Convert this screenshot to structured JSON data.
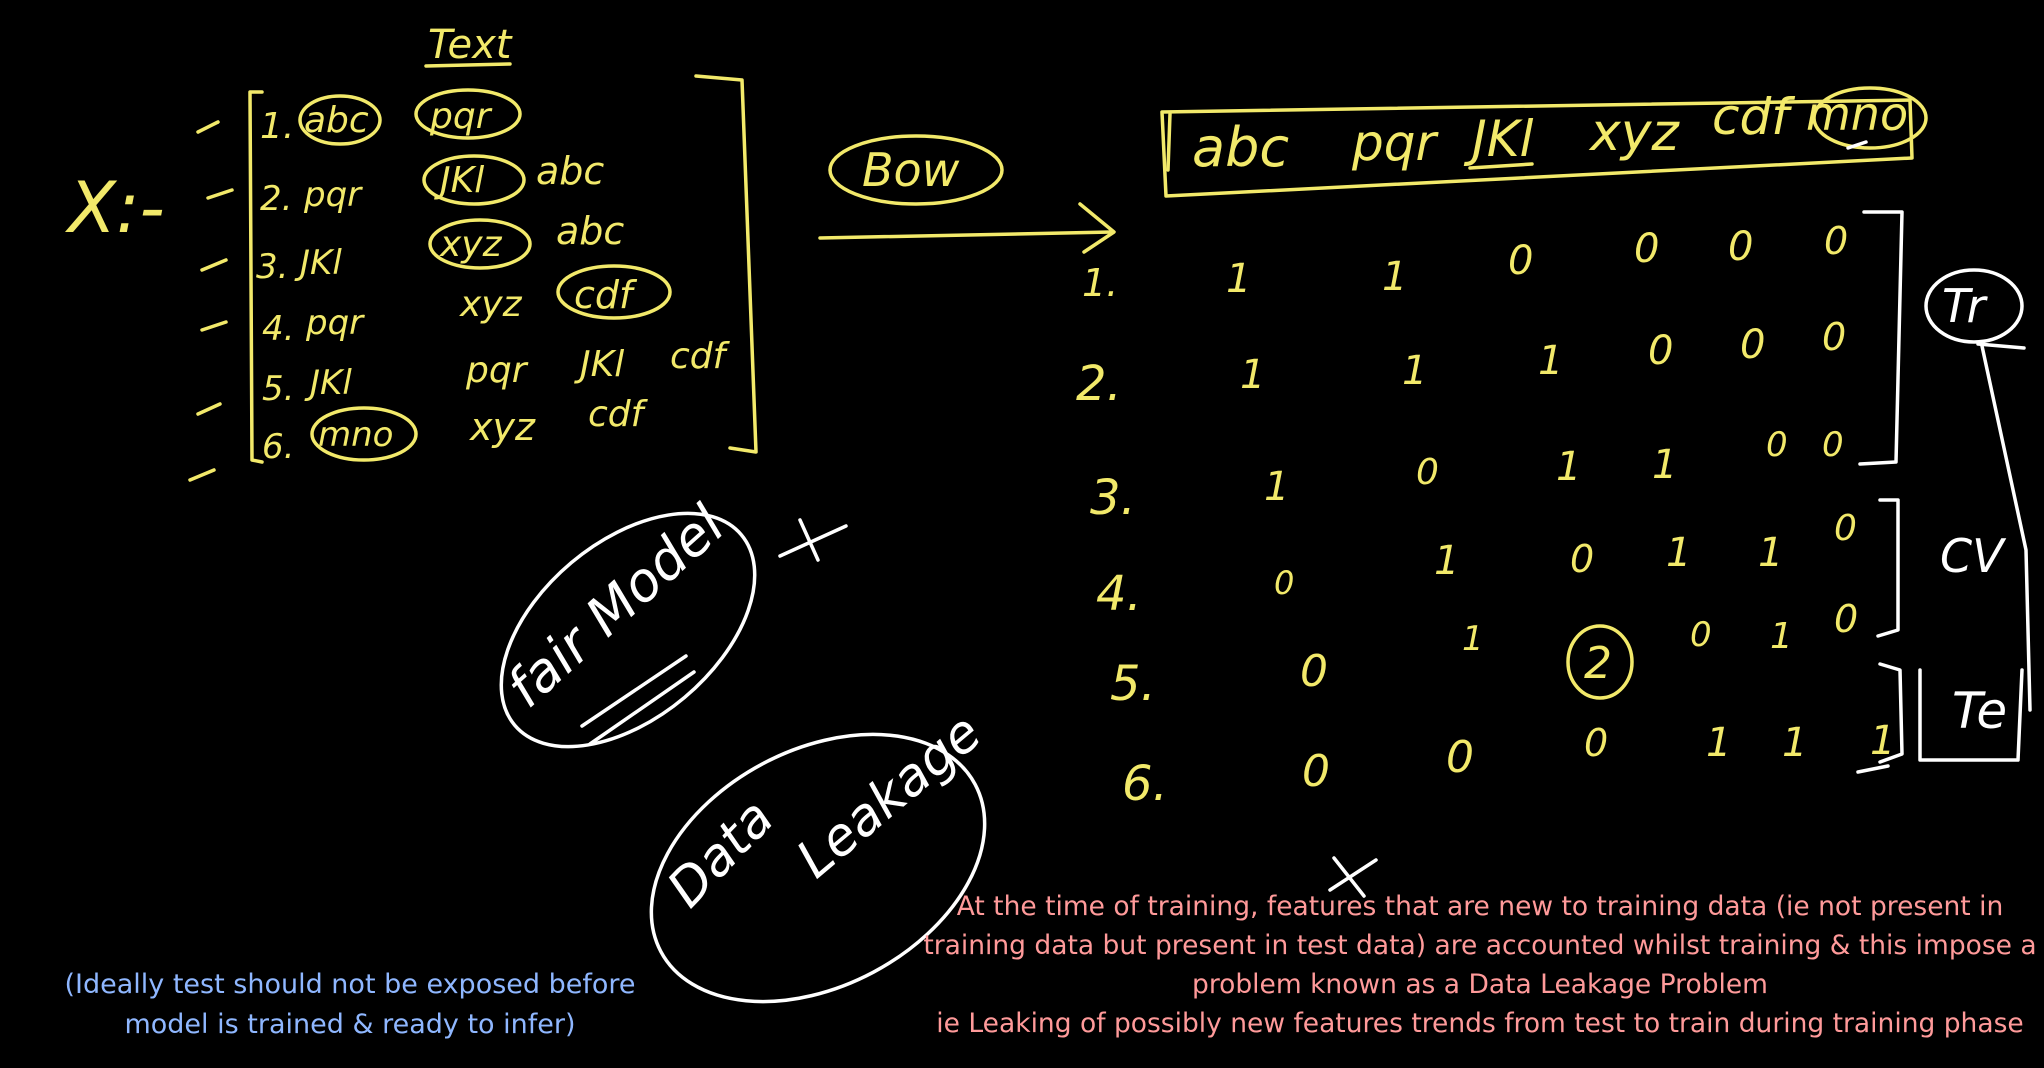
{
  "colors": {
    "background": "#000000",
    "ink_yellow": "#f2e96a",
    "ink_white": "#ffffff",
    "note_blue": "#8fb7ff",
    "note_pink": "#ff9a9a"
  },
  "left_block": {
    "x_label": "X:-",
    "column_header": "Text",
    "rows": [
      {
        "num": "1.",
        "words": [
          "abc",
          "pqr"
        ]
      },
      {
        "num": "2.",
        "words": [
          "pqr",
          "JKl",
          "abc"
        ]
      },
      {
        "num": "3.",
        "words": [
          "JKl",
          "xyz",
          "abc"
        ]
      },
      {
        "num": "4.",
        "words": [
          "pqr",
          "xyz",
          "cdf"
        ]
      },
      {
        "num": "5.",
        "words": [
          "JKl",
          "pqr",
          "JKl",
          "cdf"
        ]
      },
      {
        "num": "6.",
        "words": [
          "mno",
          "xyz",
          "cdf"
        ]
      }
    ]
  },
  "bow_label": "Bow",
  "vocabulary": [
    "abc",
    "pqr",
    "JKl",
    "xyz",
    "cdf",
    "mno"
  ],
  "matrix": {
    "row_labels": [
      "1.",
      "2.",
      "3.",
      "4.",
      "5.",
      "6."
    ],
    "rows": [
      [
        "1",
        "1",
        "0",
        "0",
        "0",
        "0"
      ],
      [
        "1",
        "1",
        "1",
        "0",
        "0",
        "0"
      ],
      [
        "1",
        "0",
        "1",
        "1",
        "0",
        "0"
      ],
      [
        "0",
        "1",
        "0",
        "1",
        "1",
        "0"
      ],
      [
        "0",
        "1",
        "2",
        "0",
        "1",
        "0"
      ],
      [
        "0",
        "0",
        "0",
        "1",
        "1",
        "1"
      ]
    ]
  },
  "splits": {
    "train": "Tr",
    "cv": "CV",
    "test": "Te"
  },
  "bubbles": {
    "fair_model": "fair Model",
    "data_leakage_1": "Data",
    "data_leakage_2": "Leakage"
  },
  "notes": {
    "blue_lines": [
      "(Ideally test should not be exposed before",
      "model is trained & ready to infer)"
    ],
    "pink_lines": [
      "At the time of training, features that are new to training data (ie not present in",
      "training data but present in test data) are accounted whilst training & this impose a",
      "problem known as a Data Leakage Problem",
      "ie Leaking of possibly new features trends from test to train during training phase"
    ]
  }
}
